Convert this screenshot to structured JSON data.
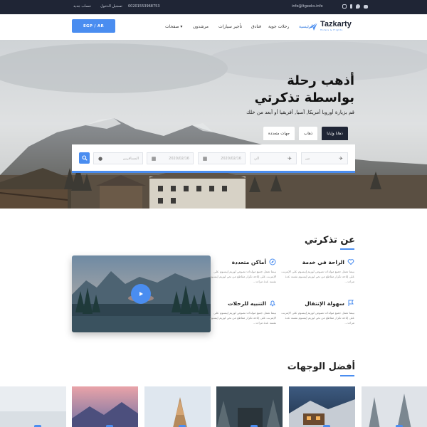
{
  "topbar": {
    "new_account": "حساب جديد",
    "login": "تسجيل الدخول",
    "phone": "00201553968753",
    "email": "info@ltgeeks.info",
    "social_icons": [
      "instagram-icon",
      "facebook-icon",
      "twitter-icon",
      "youtube-icon"
    ]
  },
  "header": {
    "currency_label": "EGP / AR",
    "nav": {
      "pages": "صفحات ▾",
      "guides": "مرشدون",
      "car_rental": "تأجير سيارات",
      "hotels": "فنادق",
      "flights": "رحلات جوية",
      "home": "الرئيسية"
    },
    "logo_name": "Tazkarty",
    "logo_tagline": "Hotels & Flights"
  },
  "hero": {
    "title_line1": "أذهب رحلة",
    "title_line2": "بواسطة تذكرتي",
    "subtitle": "قم بزيارة أوروبا أمريكا, آسيا, أفريقيا أو أبعد من خلك",
    "tabs": {
      "round_trip": "ذهابا وإيابا",
      "one_way": "ذهاب",
      "multi": "جهات متعددة"
    },
    "search": {
      "from": "من",
      "to": "الي",
      "depart_date": "2020/02/16",
      "return_date": "2020/02/16",
      "passengers": "المسافرين"
    }
  },
  "about": {
    "title": "عن تذكرتي",
    "features": {
      "comfort_title": "الراحة في خدمة",
      "comfort_text": "بينما تعمل جميع مولدات نصوص لوريم إيبسوم على الإنترنت على إتاحة تكرار مقاطع من نص لوريم إيبسوم نفسه عدة مرات...",
      "places_title": "أماكن متعددة",
      "places_text": "بينما تعمل جميع مولدات نصوص لوريم إيبسوم على الإنترنت على إتاحة تكرار مقاطع من نص لوريم إيبسوم نفسه عدة مرات...",
      "mobility_title": "سهولة الإنتقال",
      "mobility_text": "بينما تعمل جميع مولدات نصوص لوريم إيبسوم على الإنترنت على إتاحة تكرار مقاطع من نص لوريم إيبسوم نفسه عدة مرات...",
      "alerts_title": "التنبيه للرحلات",
      "alerts_text": "بينما تعمل جميع مولدات نصوص لوريم إيبسوم على الإنترنت على إتاحة تكرار مقاطع من نص لوريم إيبسوم نفسه عدة مرات..."
    }
  },
  "destinations": {
    "title": "أفضل الوجهات"
  },
  "colors": {
    "accent": "#4a8df0",
    "dark": "#1f2535"
  }
}
